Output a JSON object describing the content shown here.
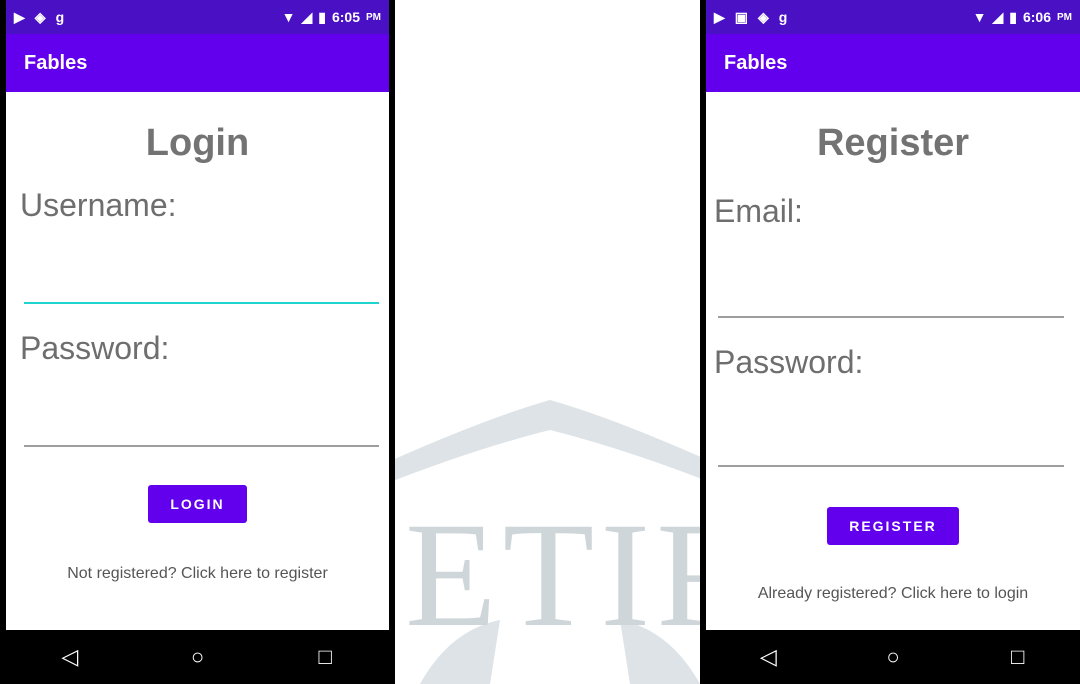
{
  "watermark": {
    "text": "ETIR"
  },
  "left": {
    "status": {
      "time": "6:05",
      "ampm": "PM",
      "app_icons": [
        "video-icon",
        "puzzle-icon",
        "g-icon"
      ]
    },
    "app_title": "Fables",
    "screen_title": "Login",
    "field1_label": "Username:",
    "field2_label": "Password:",
    "button_label": "LOGIN",
    "link_text": "Not registered? Click here to register"
  },
  "right": {
    "status": {
      "time": "6:06",
      "ampm": "PM",
      "app_icons": [
        "video-icon",
        "image-icon",
        "puzzle-icon",
        "g-icon"
      ]
    },
    "app_title": "Fables",
    "screen_title": "Register",
    "field1_label": "Email:",
    "field2_label": "Password:",
    "button_label": "REGISTER",
    "link_text": "Already registered? Click here to login"
  },
  "colors": {
    "statusbar": "#4a10c4",
    "appbar": "#6200ee",
    "focus_line": "#1fd4cf",
    "label": "#6e6e6e"
  }
}
